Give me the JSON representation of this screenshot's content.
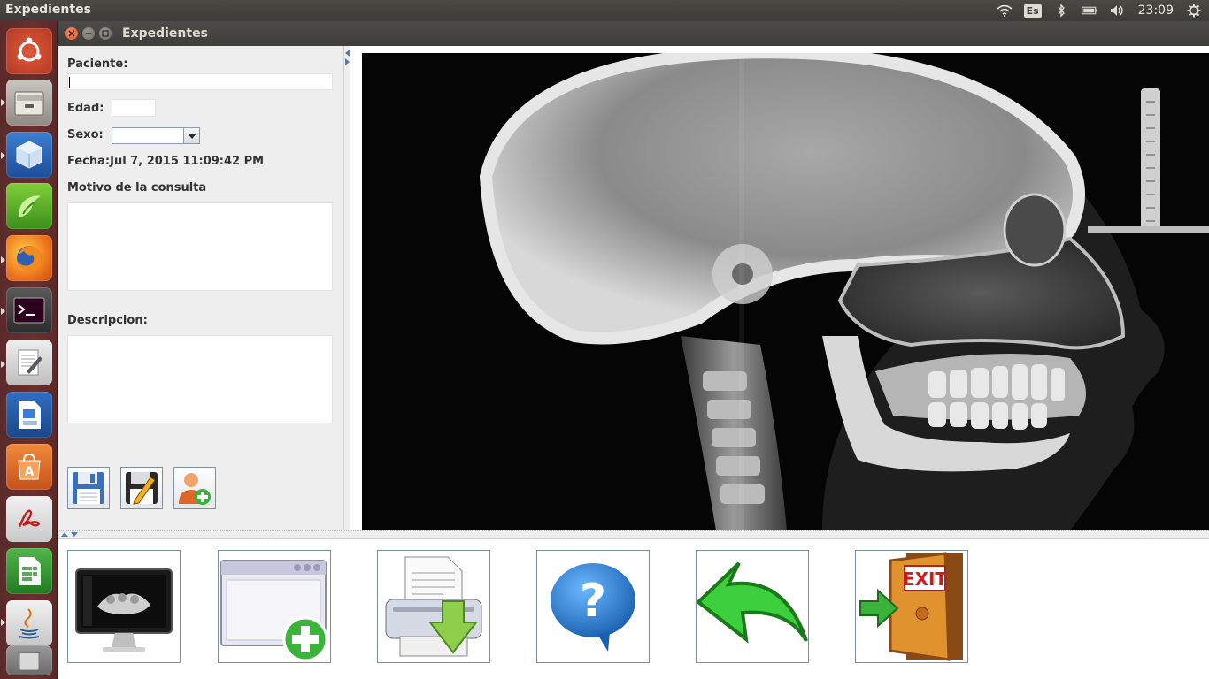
{
  "top_panel": {
    "app_title": "Expedientes",
    "language": "Es",
    "clock": "23:09"
  },
  "launcher": {
    "items": [
      "ubuntu-dash",
      "files",
      "virtualbox",
      "gimp",
      "firefox",
      "terminal",
      "text-editor",
      "writer",
      "software-center",
      "adobe-reader",
      "calc",
      "java",
      "trash"
    ]
  },
  "window": {
    "title": "Expedientes"
  },
  "form": {
    "paciente_label": "Paciente:",
    "paciente_value": "",
    "edad_label": "Edad:",
    "edad_value": "",
    "sexo_label": "Sexo:",
    "sexo_value": "",
    "fecha_label": "Fecha:",
    "fecha_value": "Jul 7, 2015 11:09:42 PM",
    "motivo_label": "Motivo de la consulta",
    "motivo_value": "",
    "descripcion_label": "Descripcion:",
    "descripcion_value": ""
  },
  "toolbar": {
    "buttons": [
      "save",
      "edit-save",
      "add-patient"
    ]
  },
  "bottom_bar": {
    "buttons": [
      "dental-scan-viewer",
      "new-window",
      "print",
      "help",
      "back",
      "exit"
    ],
    "exit_sign": "EXIT"
  },
  "colors": {
    "launcher_bg": "#6b2f2f",
    "panel_bg": "#3c3b37",
    "close_button": "#e5582f"
  }
}
